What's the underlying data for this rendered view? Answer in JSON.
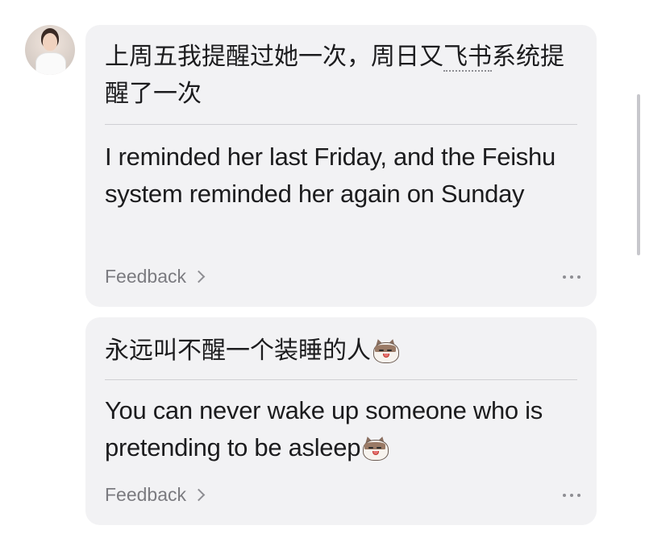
{
  "messages": [
    {
      "original": "上周五我提醒过她一次，周日又飞书系统提醒了一次",
      "original_parts": [
        "上周五我提醒过她一次，周日又",
        "飞书",
        "系统提醒了一次"
      ],
      "translation": "I reminded her last Friday, and the Feishu system reminded her again on Sunday",
      "feedback_label": "Feedback"
    },
    {
      "original": "永远叫不醒一个装睡的人",
      "translation": "You can never wake up someone who is pretending to be asleep",
      "feedback_label": "Feedback",
      "emoji": "cat-face-emoji"
    }
  ],
  "icons": {
    "avatar": "user-avatar",
    "feedback_chevron": "chevron-right-icon",
    "more": "more-horizontal-icon"
  },
  "colors": {
    "bubble_bg": "#f2f2f4",
    "text": "#1c1c1e",
    "secondary_text": "#7b7b80",
    "divider": "#cfcfd3"
  }
}
